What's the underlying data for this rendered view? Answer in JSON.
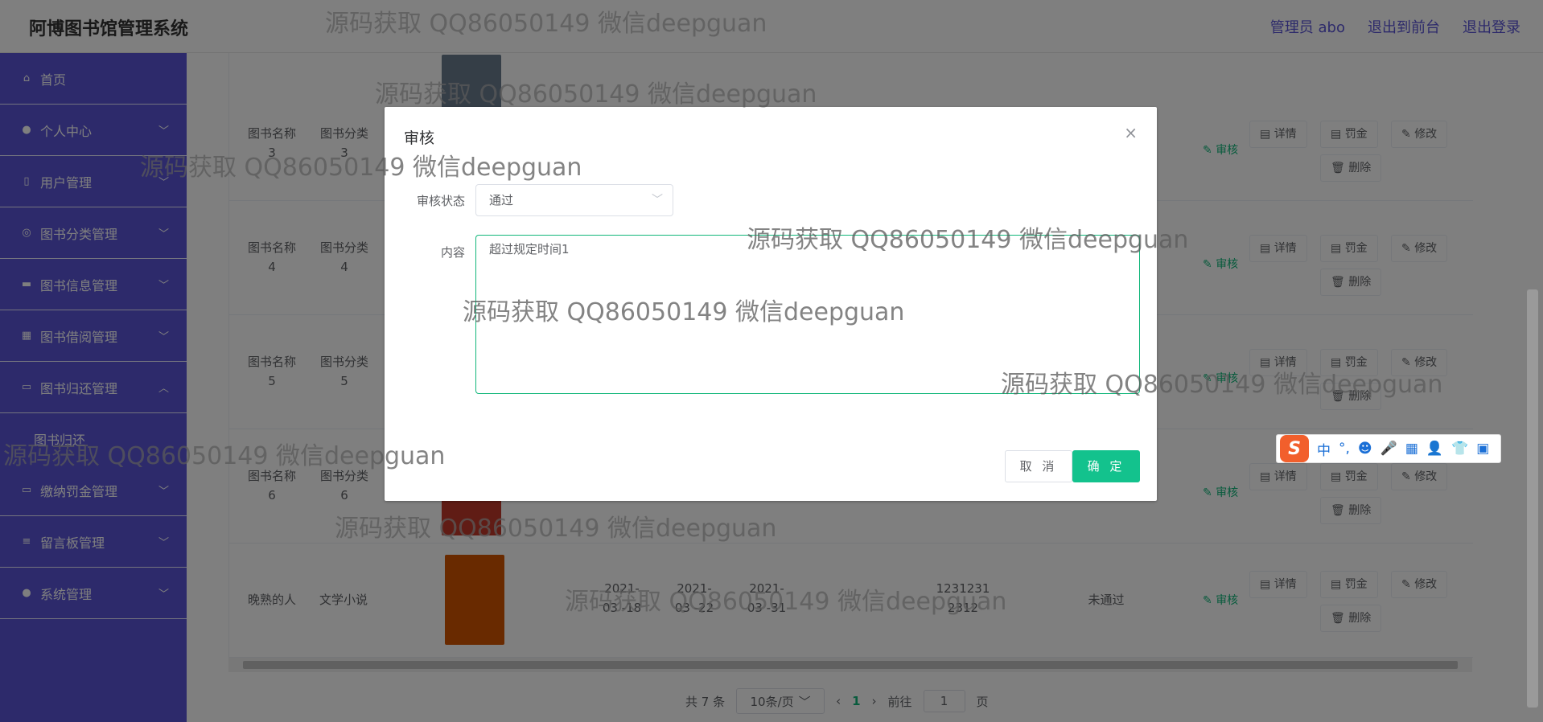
{
  "header": {
    "brand": "阿博图书馆管理系统",
    "links": [
      "管理员 abo",
      "退出到前台",
      "退出登录"
    ]
  },
  "sidebar": {
    "items": [
      {
        "label": "首页",
        "icon": "home-icon",
        "chevron": ""
      },
      {
        "label": "个人中心",
        "icon": "user-icon",
        "chevron": "chevron-down"
      },
      {
        "label": "用户管理",
        "icon": "phone-icon",
        "chevron": "chevron-down"
      },
      {
        "label": "图书分类管理",
        "icon": "target-icon",
        "chevron": "chevron-down"
      },
      {
        "label": "图书信息管理",
        "icon": "briefcase-icon",
        "chevron": "chevron-down"
      },
      {
        "label": "图书借阅管理",
        "icon": "calendar-icon",
        "chevron": "chevron-down"
      },
      {
        "label": "图书归还管理",
        "icon": "monitor-icon",
        "chevron": "chevron-up"
      },
      {
        "label": "缴纳罚金管理",
        "icon": "screen-icon",
        "chevron": "chevron-down"
      },
      {
        "label": "留言板管理",
        "icon": "list-icon",
        "chevron": "chevron-down"
      },
      {
        "label": "系统管理",
        "icon": "location-icon",
        "chevron": "chevron-down"
      }
    ],
    "sub_item": "图书归还"
  },
  "table": {
    "rows": [
      {
        "name": "图书名称 3",
        "category": "图书分类 3",
        "status": "",
        "audit": "审核"
      },
      {
        "name": "图书名称 4",
        "category": "图书分类 4",
        "status": "",
        "audit": "审核"
      },
      {
        "name": "图书名称 5",
        "category": "图书分类 5",
        "status": "",
        "audit": "审核"
      },
      {
        "name": "图书名称 6",
        "category": "图书分类 6",
        "status": "",
        "audit": "审核"
      },
      {
        "name": "晚熟的人",
        "category": "文学小说",
        "d1": "2021-03 -18",
        "d2": "2021-03 -22",
        "d3": "2021-03 -31",
        "num": "1231231 2312",
        "status": "未通过",
        "audit": "审核"
      }
    ],
    "ops": {
      "detail": "详情",
      "fine": "罚金",
      "edit": "修改",
      "delete": "删除"
    }
  },
  "pager": {
    "total": "共 7 条",
    "page_size": "10条/页",
    "current": "1",
    "goto_label": "前往",
    "goto_value": "1",
    "page_suffix": "页"
  },
  "dialog": {
    "title": "审核",
    "status_label": "审核状态",
    "status_value": "通过",
    "content_label": "内容",
    "content_value": "超过规定时间1",
    "cancel": "取 消",
    "confirm": "确 定"
  },
  "ime": {
    "mode": "中",
    "punct": "°,"
  },
  "watermark": "源码获取 QQ86050149 微信deepguan",
  "colors": {
    "sidebar": "#5a55d6",
    "accent": "#13c28d",
    "link": "#11b67a"
  }
}
